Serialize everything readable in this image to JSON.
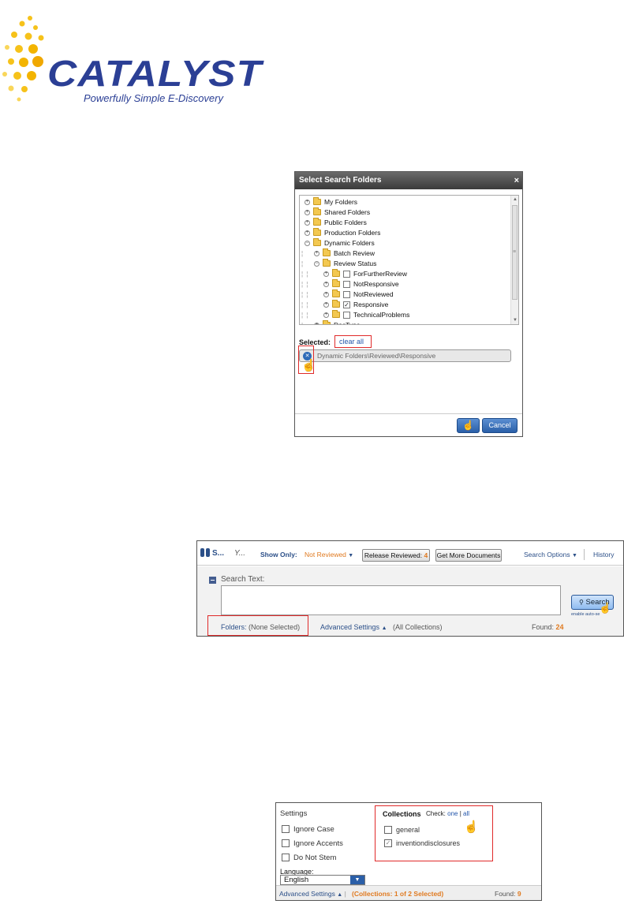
{
  "logo": {
    "wordmark": "CATALYST",
    "tagline": "Powerfully Simple E-Discovery"
  },
  "dialog": {
    "title": "Select Search Folders",
    "close_glyph": "×",
    "tree": [
      {
        "label": "My Folders",
        "level": 0,
        "expander": "+",
        "checkbox": false,
        "checked": false
      },
      {
        "label": "Shared Folders",
        "level": 0,
        "expander": "+",
        "checkbox": false,
        "checked": false
      },
      {
        "label": "Public Folders",
        "level": 0,
        "expander": "+",
        "checkbox": false,
        "checked": false
      },
      {
        "label": "Production Folders",
        "level": 0,
        "expander": "+",
        "checkbox": false,
        "checked": false
      },
      {
        "label": "Dynamic Folders",
        "level": 0,
        "expander": "−",
        "checkbox": false,
        "checked": false
      },
      {
        "label": "Batch Review",
        "level": 1,
        "expander": "+",
        "checkbox": false,
        "checked": false
      },
      {
        "label": "Review Status",
        "level": 1,
        "expander": "−",
        "checkbox": false,
        "checked": false
      },
      {
        "label": "ForFurtherReview",
        "level": 2,
        "expander": "+",
        "checkbox": true,
        "checked": false
      },
      {
        "label": "NotResponsive",
        "level": 2,
        "expander": "+",
        "checkbox": true,
        "checked": false
      },
      {
        "label": "NotReviewed",
        "level": 2,
        "expander": "+",
        "checkbox": true,
        "checked": false
      },
      {
        "label": "Responsive",
        "level": 2,
        "expander": "+",
        "checkbox": true,
        "checked": true
      },
      {
        "label": "TechnicalProblems",
        "level": 2,
        "expander": "+",
        "checkbox": true,
        "checked": false
      },
      {
        "label": "DocType",
        "level": 1,
        "expander": "+",
        "checkbox": false,
        "checked": false
      }
    ],
    "selected_label": "Selected:",
    "clear_all": "clear all",
    "selected_item": "Dynamic Folders\\Reviewed\\Responsive",
    "cancel_label": "Cancel"
  },
  "search": {
    "title_initial": "S...",
    "title_second": "Y...",
    "show_only_label": "Show Only:",
    "show_only_value": "Not Reviewed",
    "release_label": "Release Reviewed:",
    "release_count": "4",
    "get_more_label": "Get More Documents",
    "search_options": "Search Options",
    "history": "History",
    "search_text_label": "Search Text:",
    "search_button": "Search",
    "enable_auto": "enable auto-se",
    "folders_label": "Folders:",
    "folders_value": "(None Selected)",
    "advanced_settings": "Advanced Settings",
    "all_collections": "(All Collections)",
    "found_label": "Found:",
    "found_count": "24"
  },
  "settings": {
    "title": "Settings",
    "options": [
      {
        "label": "Ignore Case",
        "checked": false
      },
      {
        "label": "Ignore Accents",
        "checked": false
      },
      {
        "label": "Do Not Stem",
        "checked": false
      }
    ],
    "language_label": "Language:",
    "language_value": "English",
    "collections_title": "Collections",
    "check_label": "Check:",
    "check_one": "one",
    "check_sep": "|",
    "check_all": "all",
    "collections": [
      {
        "label": "general",
        "checked": false
      },
      {
        "label": "inventiondisclosures",
        "checked": true
      }
    ],
    "advanced_settings": "Advanced Settings",
    "collections_summary": "(Collections: 1 of 2 Selected)",
    "found_label": "Found:",
    "found_count": "9"
  },
  "colors": {
    "brand_blue": "#2b3f95",
    "link_blue": "#2b4f88",
    "accent_orange": "#e07a20",
    "highlight_red": "#e02a2a",
    "button_blue": "#2a5fa8"
  }
}
